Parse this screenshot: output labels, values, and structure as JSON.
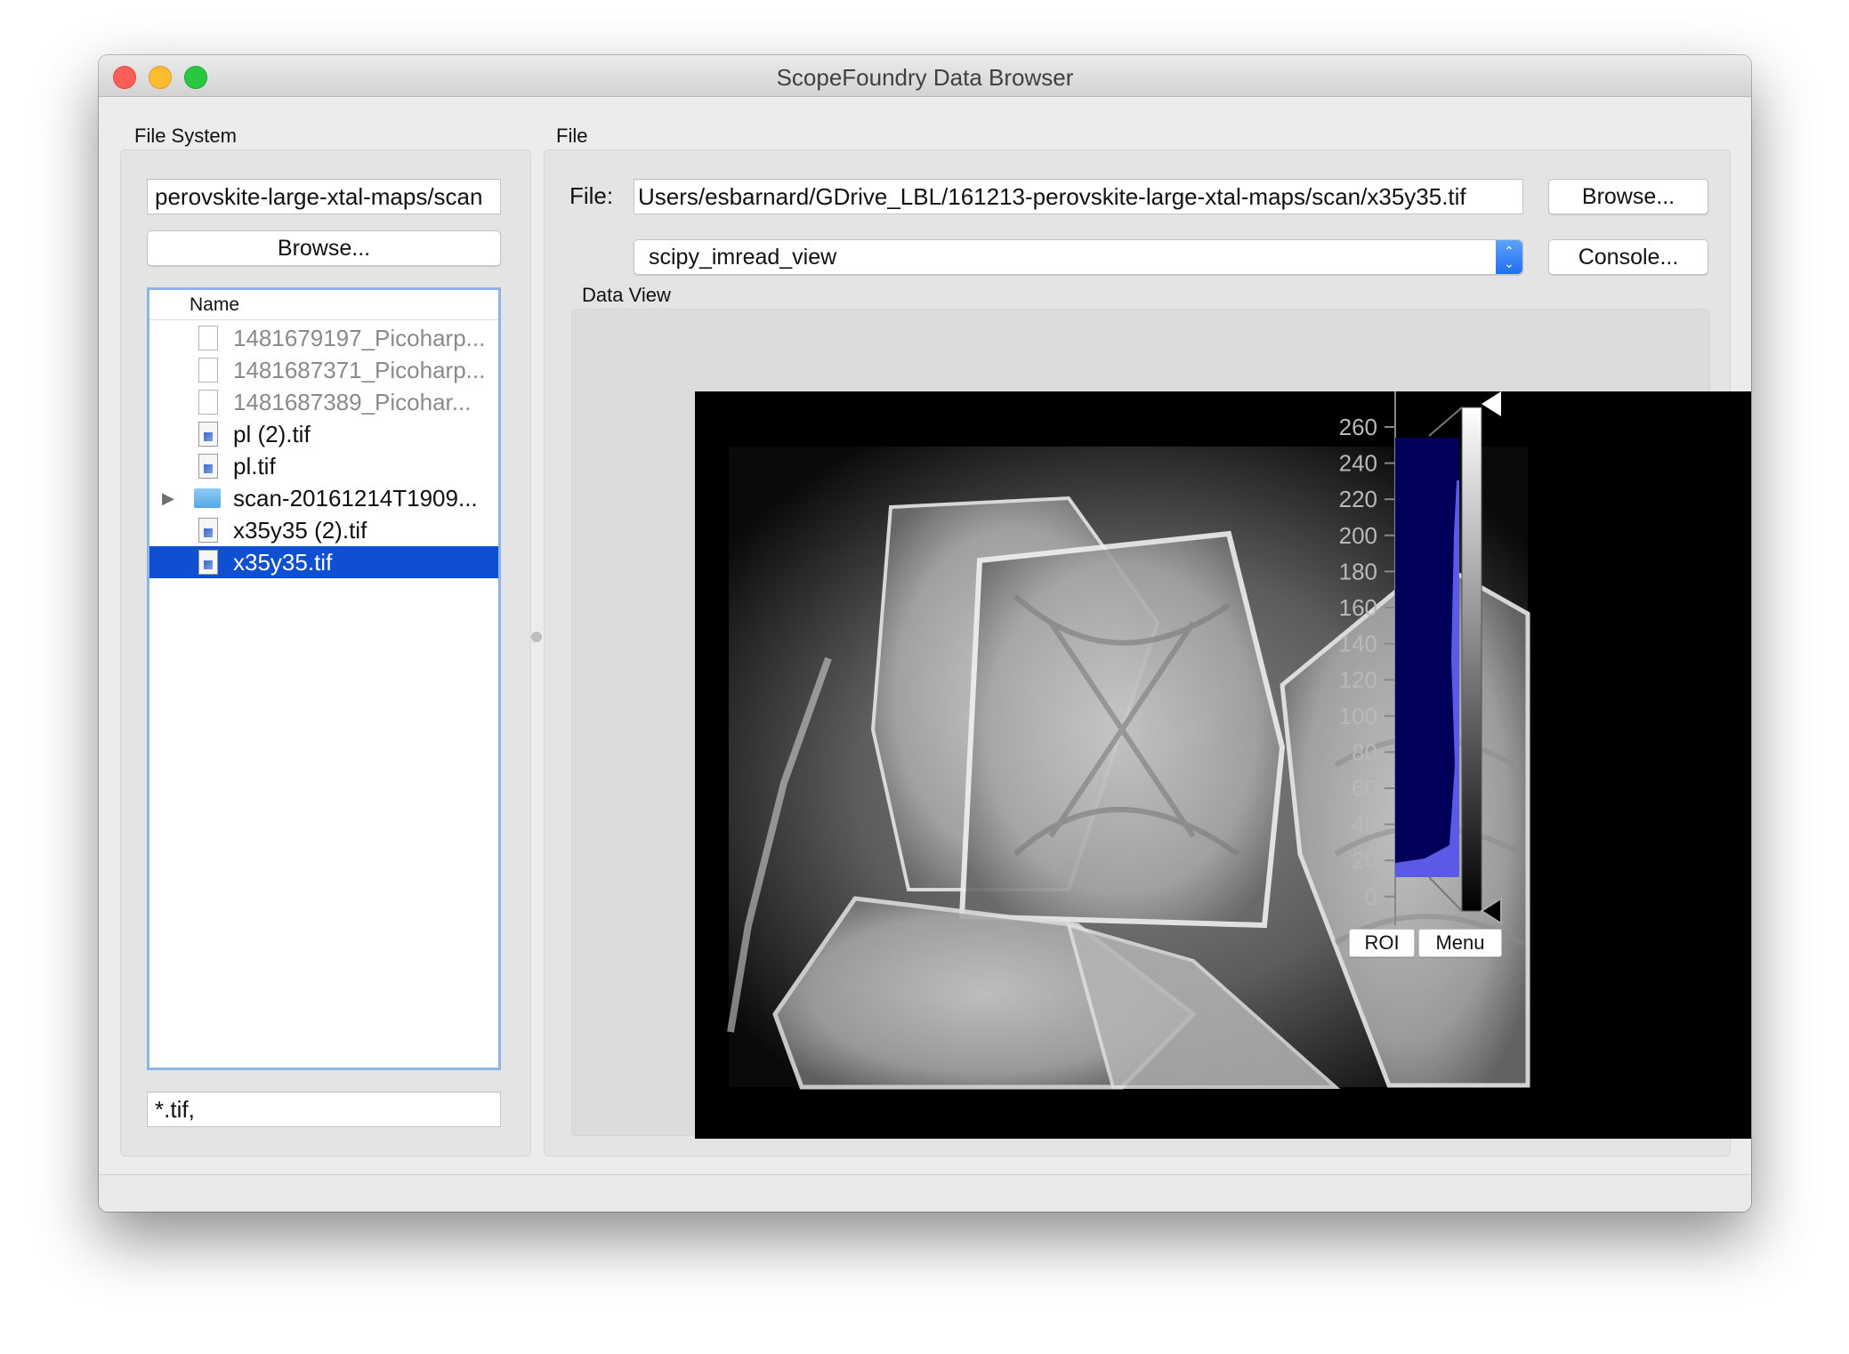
{
  "window": {
    "title": "ScopeFoundry Data Browser"
  },
  "filesystem": {
    "label": "File System",
    "path_value": "perovskite-large-xtal-maps/scan",
    "browse_label": "Browse...",
    "tree_header": "Name",
    "items": [
      {
        "label": "1481679197_Picoharp...",
        "kind": "file",
        "dim": true
      },
      {
        "label": "1481687371_Picoharp...",
        "kind": "file",
        "dim": true
      },
      {
        "label": "1481687389_Picohar...",
        "kind": "file",
        "dim": true
      },
      {
        "label": "pl (2).tif",
        "kind": "tif",
        "dim": false
      },
      {
        "label": "pl.tif",
        "kind": "tif",
        "dim": false
      },
      {
        "label": "scan-20161214T1909...",
        "kind": "folder",
        "dim": false
      },
      {
        "label": "x35y35 (2).tif",
        "kind": "tif",
        "dim": false
      },
      {
        "label": "x35y35.tif",
        "kind": "tif",
        "dim": false,
        "selected": true
      }
    ],
    "filter_value": "*.tif,"
  },
  "file": {
    "label": "File",
    "field_label": "File:",
    "path_value": "Users/esbarnard/GDrive_LBL/161213-perovskite-large-xtal-maps/scan/x35y35.tif",
    "browse_label": "Browse...",
    "view_selected": "scipy_imread_view",
    "console_label": "Console..."
  },
  "data_view": {
    "label": "Data View",
    "roi_label": "ROI",
    "menu_label": "Menu",
    "histogram_ticks": [
      "260",
      "240",
      "220",
      "200",
      "180",
      "160",
      "140",
      "120",
      "100",
      "80",
      "60",
      "40",
      "20",
      "0"
    ],
    "histogram_color": "#5a5ae6",
    "histogram_bg": "#00005a"
  }
}
